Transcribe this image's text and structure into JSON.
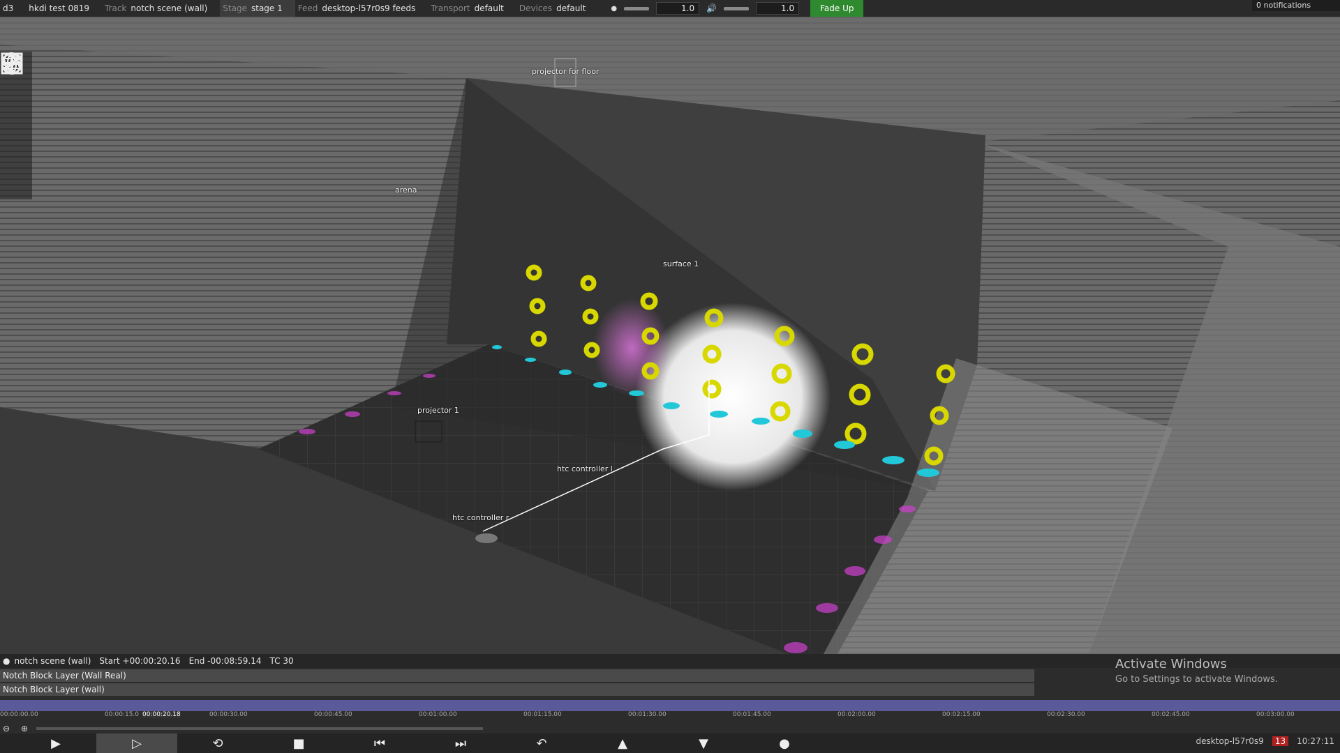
{
  "topbar": {
    "app": "d3",
    "project": "hkdi test 0819",
    "track_label": "Track",
    "track_value": "notch scene (wall)",
    "stage_label": "Stage",
    "stage_value": "stage 1",
    "feed_label": "Feed",
    "feed_value": "desktop-l57r0s9 feeds",
    "transport_label": "Transport",
    "transport_value": "default",
    "devices_label": "Devices",
    "devices_value": "default",
    "brightness_value": "1.0",
    "volume_value": "1.0",
    "fade_button": "Fade Up",
    "notifications": "0 notifications"
  },
  "tools": {
    "mode": "3D",
    "icons": [
      "move-icon",
      "rotate-icon",
      "scale-icon",
      "globe-icon"
    ]
  },
  "scene_labels": {
    "projector_floor": "projector for floor",
    "arena": "arena",
    "surface": "surface 1",
    "projector": "projector 1",
    "htc_controller_l": "htc controller l",
    "htc_controller_r": "htc controller r"
  },
  "timeline": {
    "track_name": "notch scene (wall)",
    "start": "Start +00:00:20.16",
    "end": "End -00:08:59.14",
    "tc": "TC 30",
    "layers": [
      "Notch Block Layer (Wall Real)",
      "Notch Block Layer (wall)"
    ],
    "ticks": [
      "00:00:00.00",
      "00:00:15.0",
      "00:00:30.00",
      "00:00:45.00",
      "00:01:00.00",
      "00:01:15.00",
      "00:01:30.00",
      "00:01:45.00",
      "00:02:00.00",
      "00:02:15.00",
      "00:02:30.00",
      "00:02:45.00",
      "00:03:00.00"
    ],
    "playhead": "00:00:20.18",
    "watermark_title": "Activate Windows",
    "watermark_sub": "Go to Settings to activate Windows.",
    "machine": "desktop-l57r0s9",
    "alert_count": "13",
    "clock": "10:27:11"
  },
  "colors": {
    "accent_green": "#2f8a2f",
    "alert_red": "#b02020",
    "ruler": "#5a5a9a",
    "marker_yellow": "#d8d800",
    "marker_cyan": "#22c8d8",
    "marker_magenta": "#d040d0"
  }
}
